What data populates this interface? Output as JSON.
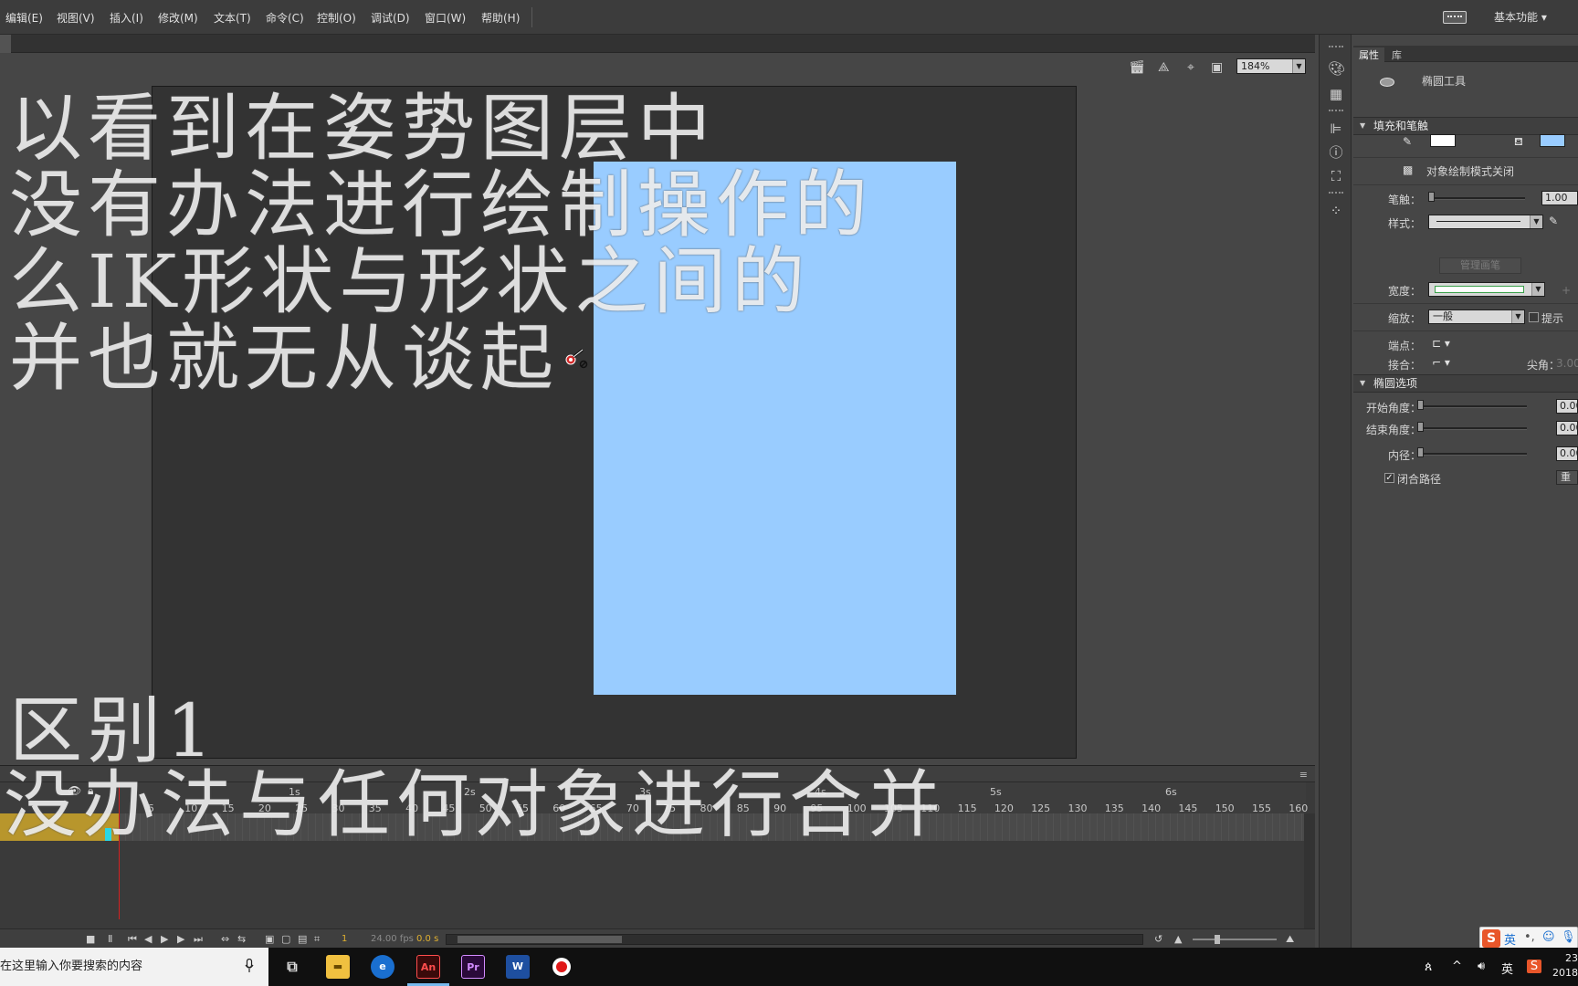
{
  "menu": {
    "items": [
      "编辑(E)",
      "视图(V)",
      "插入(I)",
      "修改(M)",
      "文本(T)",
      "命令(C)",
      "控制(O)",
      "调试(D)",
      "窗口(W)",
      "帮助(H)"
    ],
    "workspace": "基本功能"
  },
  "editbar": {
    "zoom": "184%"
  },
  "stage": {
    "stage_color": "#333333",
    "shape_color": "#99ccff"
  },
  "overlay": {
    "lines": [
      "以看到在姿势图层中",
      "没有办法进行绘制操作的",
      "么IK形状与形状之间的",
      "并也就无从谈起"
    ],
    "bottom_lines": [
      "区别1",
      "没办法与任何对象进行合并"
    ]
  },
  "timeline": {
    "seconds": [
      "1s",
      "2s",
      "3s",
      "4s",
      "5s",
      "6s"
    ],
    "frame_ticks": [
      "5",
      "10",
      "15",
      "20",
      "25",
      "30",
      "35",
      "40",
      "45",
      "50",
      "55",
      "60",
      "65",
      "70",
      "75",
      "80",
      "85",
      "90",
      "95",
      "100",
      "105",
      "110",
      "115",
      "120",
      "125",
      "130",
      "135",
      "140",
      "145",
      "150",
      "155",
      "160"
    ],
    "current_frame": "1",
    "fps": "24.00 fps",
    "time": "0.0 s"
  },
  "properties": {
    "tabs": [
      "属性",
      "库"
    ],
    "tool_name": "椭圆工具",
    "fill_stroke_section": "填充和笔触",
    "stroke_color": "#ffffff",
    "fill_color": "#99ccff",
    "object_drawing_mode": "对象绘制模式关闭",
    "stroke_label": "笔触：",
    "stroke_value": "1.00",
    "style_label": "样式：",
    "manage_brush": "管理画笔",
    "width_label": "宽度：",
    "scale_label": "缩放：",
    "scale_value": "一般",
    "hint_label": "提示",
    "cap_label": "端点：",
    "join_label": "接合：",
    "miter_label": "尖角：",
    "miter_value": "3.00",
    "oval_section": "椭圆选项",
    "start_angle_label": "开始角度：",
    "start_angle_value": "0.00",
    "end_angle_label": "结束角度：",
    "end_angle_value": "0.00",
    "inner_radius_label": "内径：",
    "inner_radius_value": "0.00",
    "close_path_label": "闭合路径",
    "close_path_checked": true,
    "reset_label": "重"
  },
  "taskbar": {
    "search_placeholder": "在这里输入你要搜索的内容",
    "apps": [
      "An",
      "Pr",
      "W"
    ],
    "ime_lang": "英",
    "clock_time": "23",
    "clock_date": "2018"
  },
  "ime": {
    "label": "英"
  }
}
